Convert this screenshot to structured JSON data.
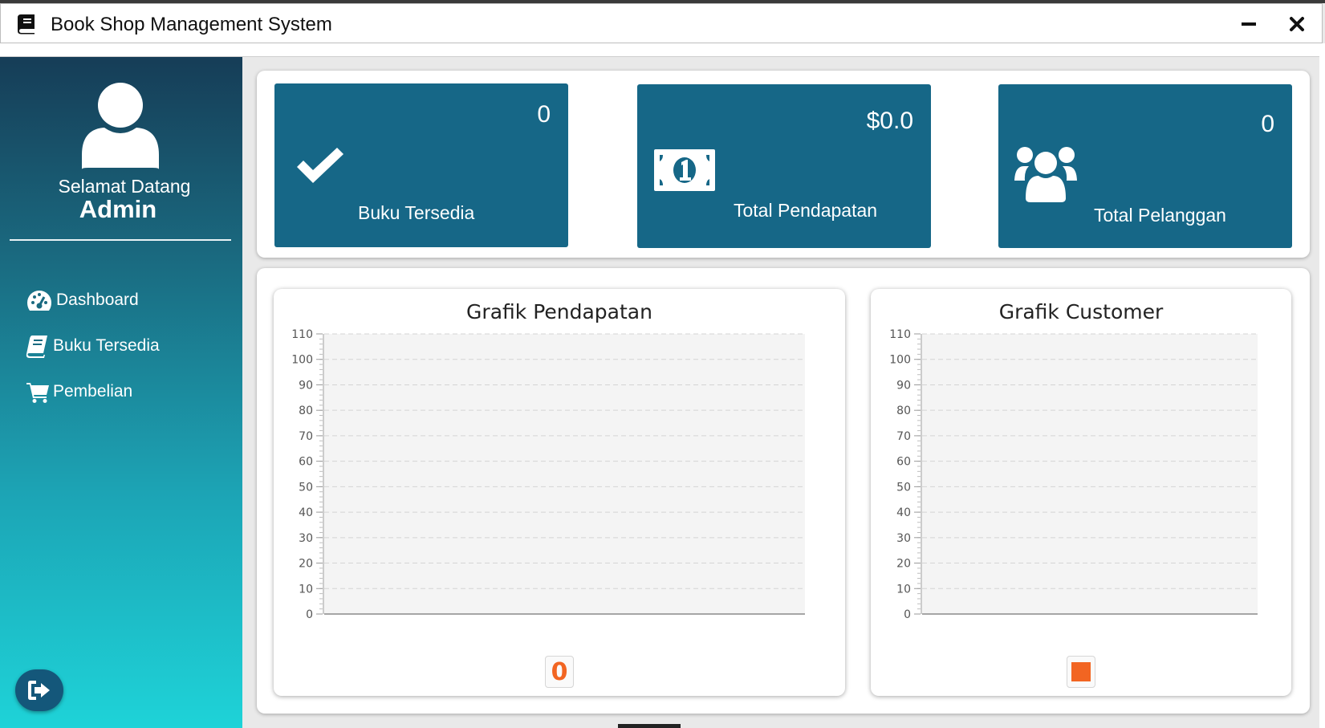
{
  "window": {
    "title": "Book Shop Management System",
    "icons": {
      "app": "book-icon",
      "minimize": "minimize-icon",
      "close": "close-icon"
    }
  },
  "sidebar": {
    "welcome_line1": "Selamat Datang",
    "welcome_line2": "Admin",
    "avatar_icon": "user-icon",
    "items": [
      {
        "label": "Dashboard",
        "icon": "dashboard-icon"
      },
      {
        "label": "Buku Tersedia",
        "icon": "book-icon"
      },
      {
        "label": "Pembelian",
        "icon": "cart-icon"
      }
    ],
    "logout_icon": "sign-out-icon"
  },
  "stats": [
    {
      "value": "0",
      "label": "Buku Tersedia",
      "icon": "check-icon"
    },
    {
      "value": "$0.0",
      "label": "Total Pendapatan",
      "icon": "money-icon"
    },
    {
      "value": "0",
      "label": "Total Pelanggan",
      "icon": "users-icon"
    }
  ],
  "colors": {
    "card_bg": "#166787",
    "sidebar_top": "#163d57",
    "sidebar_bottom": "#1ed3d8",
    "legend_accent": "#f26522"
  },
  "chart_data": [
    {
      "type": "bar",
      "title": "Grafik Pendapatan",
      "ylim": [
        0,
        110
      ],
      "yticks": [
        "0",
        "10",
        "20",
        "30",
        "40",
        "50",
        "60",
        "70",
        "80",
        "90",
        "100",
        "110"
      ],
      "series": [
        {
          "values": []
        }
      ],
      "legend": "bottom-center",
      "legend_marker": "0",
      "grid": true
    },
    {
      "type": "bar",
      "title": "Grafik Customer",
      "ylim": [
        0,
        110
      ],
      "yticks": [
        "0",
        "10",
        "20",
        "30",
        "40",
        "50",
        "60",
        "70",
        "80",
        "90",
        "100",
        "110"
      ],
      "series": [
        {
          "values": []
        }
      ],
      "legend": "bottom-center",
      "grid": true
    }
  ]
}
